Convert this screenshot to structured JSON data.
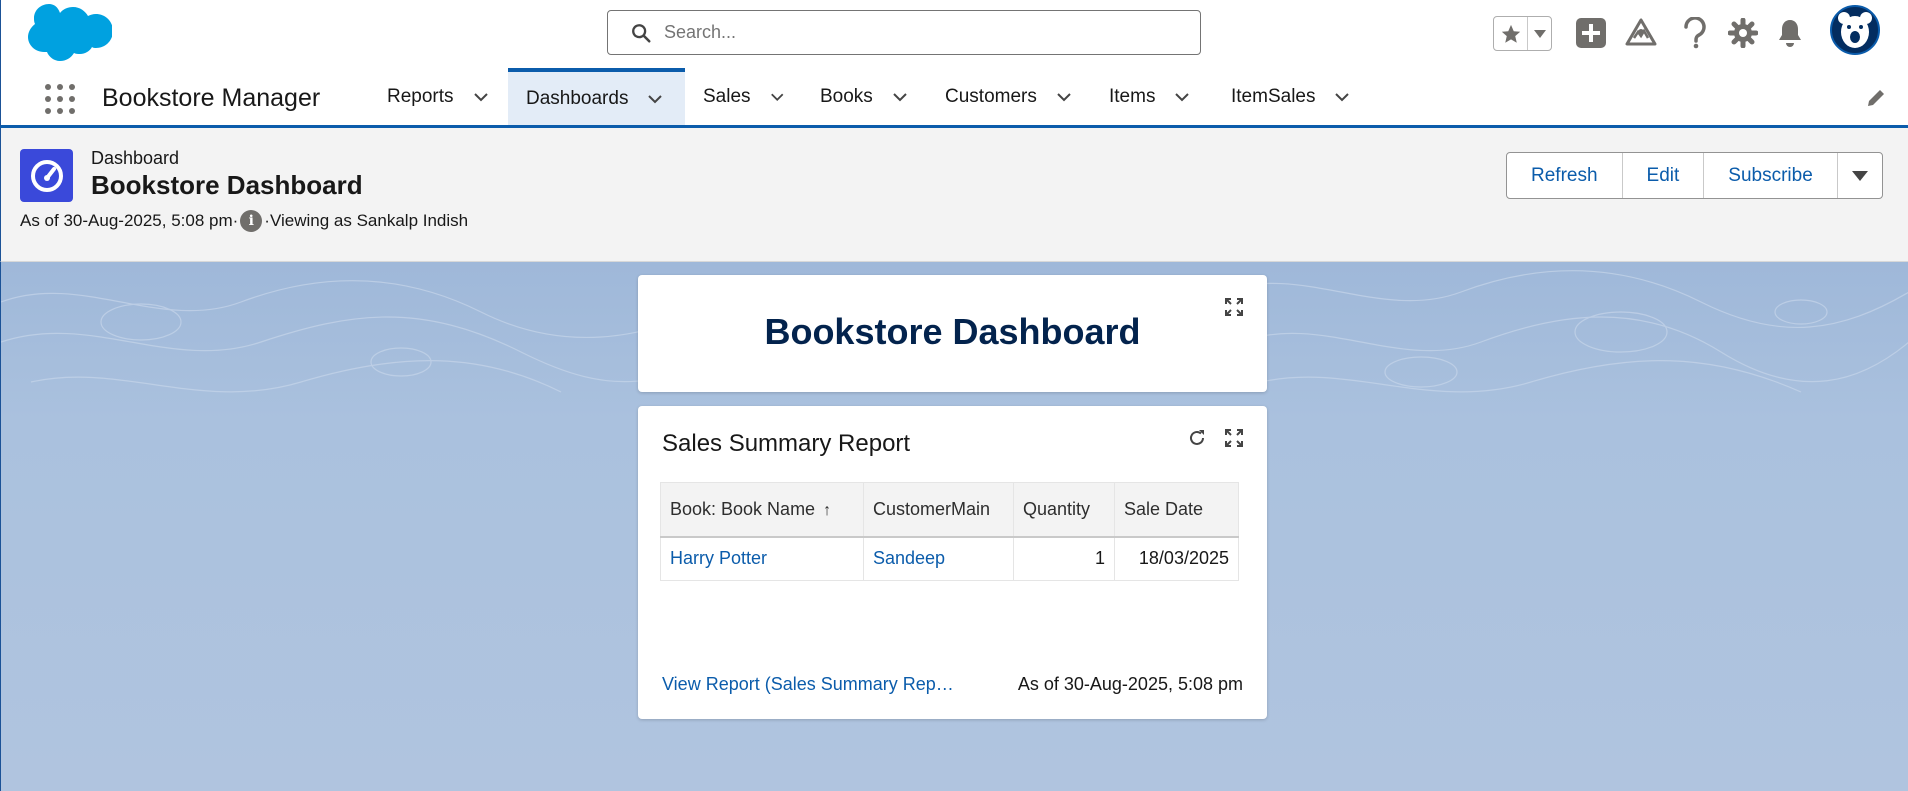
{
  "header": {
    "search_placeholder": "Search..."
  },
  "nav": {
    "app_name": "Bookstore Manager",
    "items": [
      {
        "label": "Reports"
      },
      {
        "label": "Dashboards"
      },
      {
        "label": "Sales"
      },
      {
        "label": "Books"
      },
      {
        "label": "Customers"
      },
      {
        "label": "Items"
      },
      {
        "label": "ItemSales"
      }
    ],
    "active": "Dashboards"
  },
  "page": {
    "object_label": "Dashboard",
    "title": "Bookstore Dashboard",
    "as_of": "As of 30-Aug-2025, 5:08 pm·",
    "viewing_as": "·Viewing as Sankalp Indish",
    "buttons": {
      "refresh": "Refresh",
      "edit": "Edit",
      "subscribe": "Subscribe"
    }
  },
  "dashboard": {
    "title_widget": "Bookstore Dashboard",
    "report_widget": {
      "title": "Sales Summary Report",
      "columns": [
        "Book: Book Name",
        "CustomerMain",
        "Quantity",
        "Sale Date"
      ],
      "rows": [
        {
          "book": "Harry Potter",
          "customer": "Sandeep",
          "quantity": "1",
          "sale_date": "18/03/2025"
        }
      ],
      "view_report": "View Report (Sales Summary Rep…",
      "as_of": "As of 30-Aug-2025, 5:08 pm"
    }
  },
  "colors": {
    "brand_blue": "#0b5cab",
    "dashboard_icon": "#3a49da",
    "title_navy": "#03234d"
  }
}
